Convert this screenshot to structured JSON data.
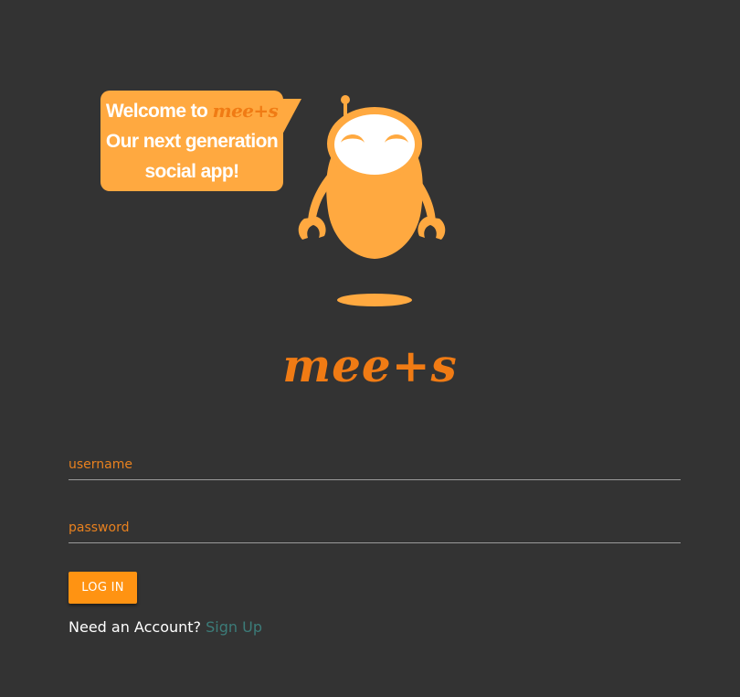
{
  "bubble": {
    "welcome_prefix": "Welcome to",
    "brand_inline": "mee+s",
    "line2": "Our next generation",
    "line3": "social app!"
  },
  "logo": {
    "text": "mee+s"
  },
  "form": {
    "username_placeholder": "username",
    "username_value": "",
    "password_placeholder": "password",
    "password_value": "",
    "login_label": "LOG IN"
  },
  "signup": {
    "prompt": "Need an Account?",
    "link_label": "Sign Up"
  },
  "colors": {
    "background": "#333333",
    "accent": "#ff9312",
    "robot": "#ffa940",
    "brand": "#f07b14",
    "link": "#3c7c79"
  },
  "icons": {
    "mascot": "robot-mascot-icon"
  }
}
